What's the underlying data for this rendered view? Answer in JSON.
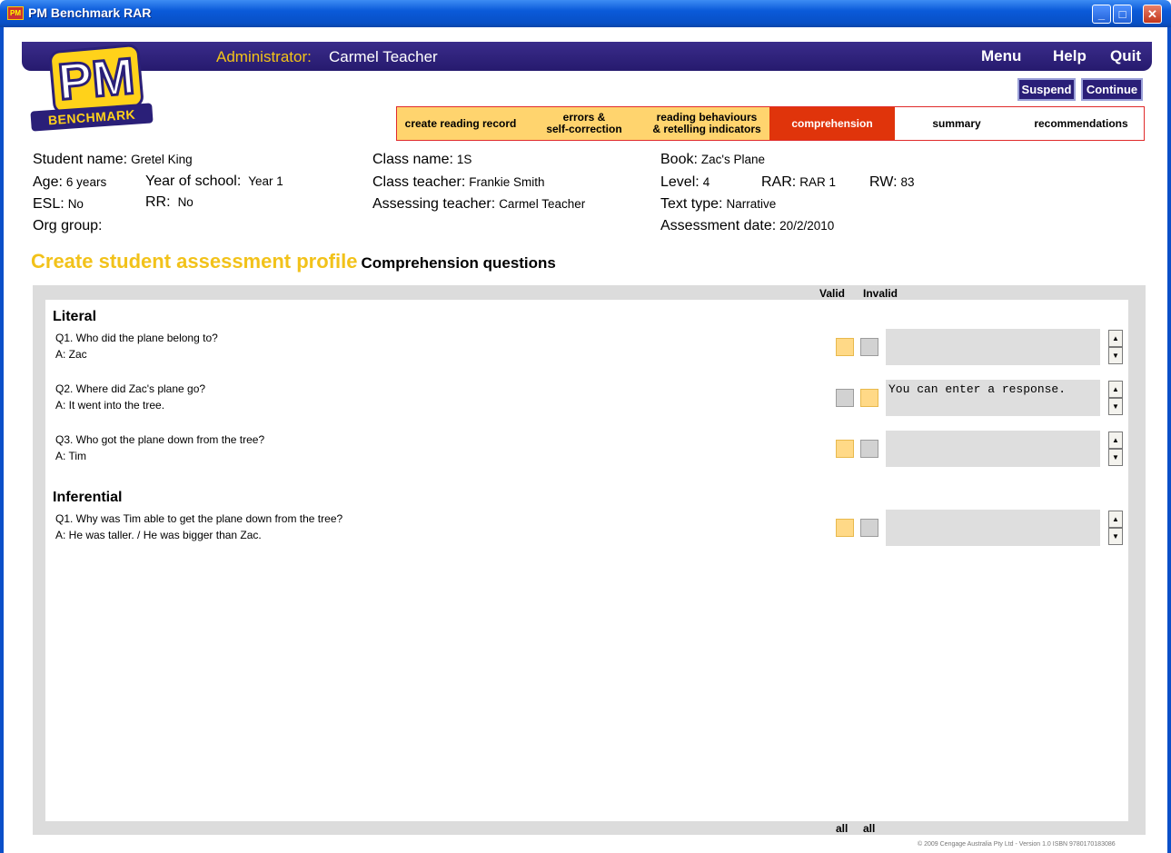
{
  "window": {
    "title": "PM Benchmark RAR"
  },
  "header": {
    "admin_label": "Administrator:",
    "admin_name": "Carmel Teacher",
    "menu": "Menu",
    "help": "Help",
    "quit": "Quit",
    "suspend": "Suspend",
    "continue": "Continue"
  },
  "logo": {
    "pm": "PM",
    "benchmark": "BENCHMARK"
  },
  "tabs": [
    {
      "label": "create reading record"
    },
    {
      "label": "errors &\nself-correction"
    },
    {
      "label": "reading behaviours\n& retelling indicators"
    },
    {
      "label": "comprehension"
    },
    {
      "label": "summary"
    },
    {
      "label": "recommendations"
    }
  ],
  "student": {
    "name_label": "Student name:",
    "name": "Gretel King",
    "age_label": "Age:",
    "age": "6 years",
    "year_label": "Year of school:",
    "year": "Year 1",
    "esl_label": "ESL:",
    "esl": "No",
    "rr_label": "RR:",
    "rr": "No",
    "org_label": "Org group:"
  },
  "class": {
    "name_label": "Class name:",
    "name": "1S",
    "teacher_label": "Class teacher:",
    "teacher": "Frankie Smith",
    "assessing_label": "Assessing teacher:",
    "assessing": "Carmel Teacher"
  },
  "book": {
    "book_label": "Book:",
    "book": "Zac's Plane",
    "level_label": "Level:",
    "level": "4",
    "rar_label": "RAR:",
    "rar": "RAR 1",
    "rw_label": "RW:",
    "rw": "83",
    "text_type_label": "Text type:",
    "text_type": "Narrative",
    "date_label": "Assessment date:",
    "date": "20/2/2010"
  },
  "page": {
    "title": "Create student assessment profile",
    "subtitle": "Comprehension questions",
    "valid_label": "Valid",
    "invalid_label": "Invalid",
    "all_valid": "all",
    "all_invalid": "all"
  },
  "sections": [
    {
      "title": "Literal",
      "questions": [
        {
          "q": "Q1.  Who did the plane belong to?",
          "a": "A: Zac",
          "valid": true,
          "response": ""
        },
        {
          "q": "Q2. Where did Zac's plane go?",
          "a": "A: It went into the tree.",
          "valid": false,
          "response": "You can enter a response."
        },
        {
          "q": "Q3. Who got the plane down from the tree?",
          "a": "A: Tim",
          "valid": true,
          "response": ""
        }
      ]
    },
    {
      "title": "Inferential",
      "questions": [
        {
          "q": "Q1. Why was Tim able to get the plane down from the tree?",
          "a": "A: He was taller. / He was bigger than Zac.",
          "valid": true,
          "response": ""
        }
      ]
    }
  ],
  "footer": "© 2009 Cengage Australia Pty Ltd - Version 1.0 ISBN 9780170183086",
  "colors": {
    "active_tab": "#e0340b",
    "brand_navy": "#2a1f78",
    "brand_yellow": "#f2c21a"
  },
  "icons": {
    "minimize": "minimize-icon",
    "maximize": "maximize-icon",
    "close": "close-icon",
    "spin_up": "arrow-up-icon",
    "spin_down": "arrow-down-icon"
  }
}
